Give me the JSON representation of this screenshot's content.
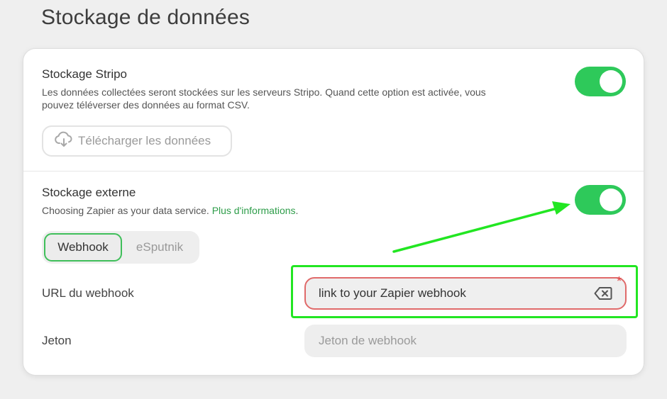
{
  "page": {
    "title": "Stockage de données"
  },
  "stripo": {
    "title": "Stockage Stripo",
    "description_line1": "Les données collectées seront stockées sur les serveurs Stripo. Quand cette option est activée, vous",
    "description_line2": "pouvez téléverser des données au format CSV.",
    "toggle_on": true,
    "download_label": "Télécharger les données"
  },
  "external": {
    "title": "Stockage externe",
    "description": "Choosing Zapier as your data service.",
    "more_link": "Plus d'informations",
    "toggle_on": true,
    "tabs": [
      {
        "label": "Webhook",
        "active": true
      },
      {
        "label": "eSputnik",
        "active": false
      }
    ],
    "webhook_url": {
      "label": "URL du webhook",
      "value": "link to your Zapier webhook",
      "required_mark": "*"
    },
    "token": {
      "label": "Jeton",
      "placeholder": "Jeton de webhook"
    }
  },
  "colors": {
    "toggle": "#2ec95a",
    "highlight": "#22e622",
    "error": "#e06a6a",
    "link": "#2e9d4a"
  },
  "icons": [
    "cloud-download-icon",
    "backspace-clear-icon"
  ]
}
